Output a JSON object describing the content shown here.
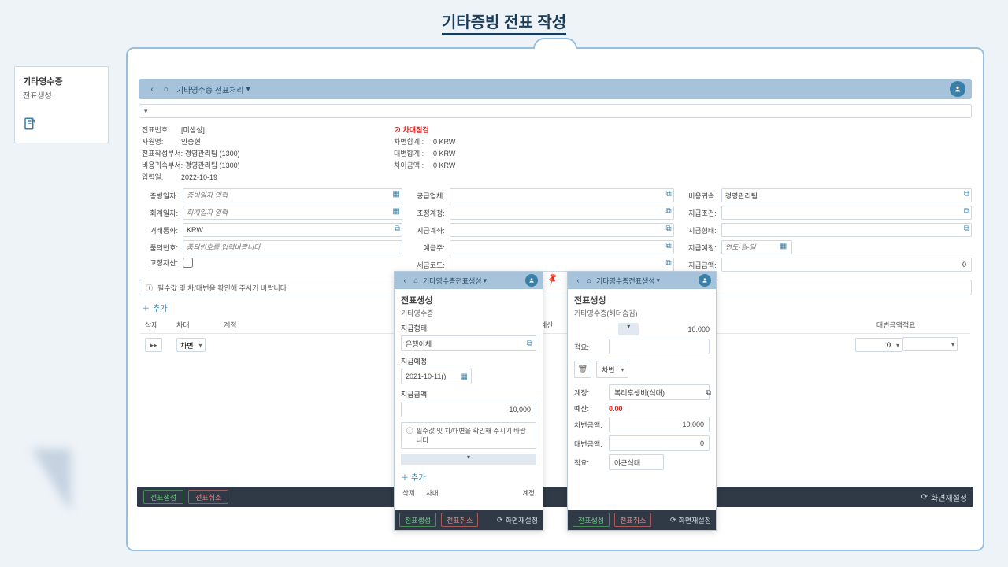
{
  "page_title": "기타증빙 전표 작성",
  "card": {
    "title": "기타영수증",
    "subtitle": "전표생성"
  },
  "topbar": {
    "breadcrumb": "기타영수증 전표처리"
  },
  "header": {
    "voucher_no_label": "전표번호:",
    "voucher_no": "[미생성]",
    "employee_label": "사원명:",
    "employee": "안승현",
    "create_dept_label": "전표작성부서:",
    "create_dept": "경영관리팀 (1300)",
    "cost_dept_label": "비용귀속부서:",
    "cost_dept": "경영관리팀 (1300)",
    "input_date_label": "입력일:",
    "input_date": "2022-10-19",
    "check_label": "차대점검",
    "debit_sum_label": "차변합계 :",
    "debit_sum": "0 KRW",
    "credit_sum_label": "대변합계 :",
    "credit_sum": "0 KRW",
    "diff_label": "차이금액 :",
    "diff": "0 KRW"
  },
  "form": {
    "evidence_date_label": "증빙일자:",
    "evidence_date_ph": "증빙일자 입력",
    "acct_date_label": "회계일자:",
    "acct_date_ph": "회계일자 입력",
    "trade_curr_label": "거래통화:",
    "trade_curr": "KRW",
    "decision_no_label": "품의번호:",
    "decision_no_ph": "품의번호를 입력바랍니다",
    "fixed_asset_label": "고정자산:",
    "supplier_label": "공급업체:",
    "adj_acct_label": "조정계정:",
    "pay_account_label": "지급계좌:",
    "deposit_owner_label": "예금주:",
    "tax_code_label": "세금코드:",
    "cost_attr_label": "비용귀속:",
    "cost_attr": "경영관리팀",
    "pay_cond_label": "지급조건:",
    "pay_form_label": "지급형태:",
    "pay_sched_label": "지급예정:",
    "pay_sched_ph": "연도-월-일",
    "pay_amt_label": "지급금액:",
    "pay_amt": "0"
  },
  "msgbar": "필수값 및 차/대변을 확인해 주시기 바랍니다",
  "add_label": "추가",
  "table": {
    "h_delete": "삭제",
    "h_dc": "차대",
    "h_acct": "계정",
    "h_budget": "예산",
    "h_credit_amt": "대변금액",
    "h_desc": "적요",
    "row_dc": "차변",
    "row_amt": "0"
  },
  "footer": {
    "create": "전표생성",
    "cancel": "전표취소",
    "reset": "화면재설정"
  },
  "popup1": {
    "crumb": "기타영수증전표생성",
    "title": "전표생성",
    "subtitle": "기타영수증",
    "pay_form_label": "지급형태:",
    "pay_form": "은행이체",
    "pay_sched_label": "지급예정:",
    "pay_sched": "2021-10-11()",
    "pay_amt_label": "지급금액:",
    "pay_amt": "10,000",
    "msg": "필수값 및 차/대변을 확인해 주시기 바랍니다",
    "add": "추가",
    "th_del": "삭제",
    "th_dc": "차대",
    "th_acct": "계정"
  },
  "popup2": {
    "crumb": "기타영수증전표생성",
    "title": "전표생성",
    "subtitle": "기타영수증(헤더숨김)",
    "top_amt": "10,000",
    "desc_label": "적요:",
    "dc_val": "차변",
    "acct_label": "계정:",
    "acct_val": "복리후생비(식대)",
    "budget_label": "예산:",
    "budget_val": "0.00",
    "debit_amt_label": "차변금액:",
    "debit_amt": "10,000",
    "credit_amt_label": "대변금액:",
    "credit_amt": "0",
    "desc2_label": "적요:",
    "desc2_val": "야근식대"
  }
}
